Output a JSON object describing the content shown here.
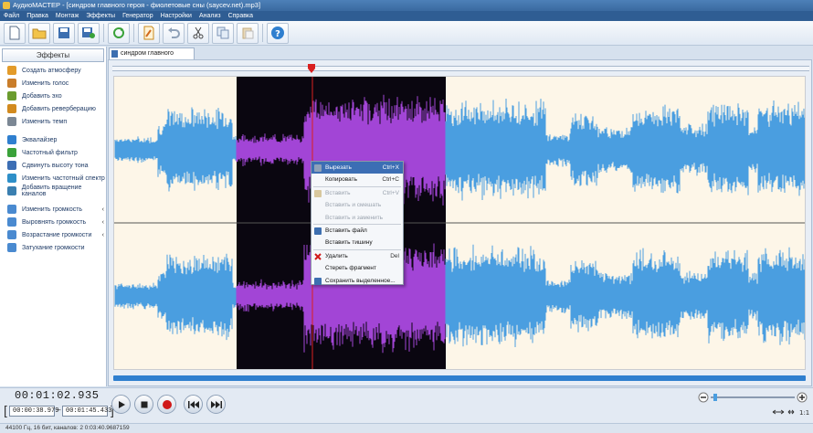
{
  "window": {
    "title": "АудиоМАСТЕР - [синдром главного героя - фиолетовые сны (saycev.net).mp3]"
  },
  "menu": [
    "Файл",
    "Правка",
    "Монтаж",
    "Эффекты",
    "Генератор",
    "Настройки",
    "Анализ",
    "Справка"
  ],
  "toolbar": {
    "icons": [
      "new-file-icon",
      "open-folder-icon",
      "save-icon",
      "save-as-icon",
      "refresh-icon",
      "edit-file-icon",
      "undo-icon",
      "cut-icon",
      "copy-icon",
      "paste-icon",
      "help-icon"
    ]
  },
  "sidebar": {
    "title": "Эффекты",
    "groups": [
      [
        {
          "label": "Создать атмосферу",
          "color": "#e39b2a"
        },
        {
          "label": "Изменить голос",
          "color": "#c97d2a"
        },
        {
          "label": "Добавить эхо",
          "color": "#6b9c2e"
        },
        {
          "label": "Добавить реверберацию",
          "color": "#d28a1e"
        },
        {
          "label": "Изменить темп",
          "color": "#7b8794"
        }
      ],
      [
        {
          "label": "Эквалайзер",
          "color": "#2f7fcf"
        },
        {
          "label": "Частотный фильтр",
          "color": "#3aa23a"
        },
        {
          "label": "Сдвинуть высоту тона",
          "color": "#3c6eb4"
        },
        {
          "label": "Изменить частотный спектр",
          "color": "#2e8fc8"
        },
        {
          "label": "Добавить вращение каналов",
          "color": "#3a7fb0"
        }
      ],
      [
        {
          "label": "Изменить громкость",
          "color": "#4a8ad0",
          "arrow": true
        },
        {
          "label": "Выровнять громкость",
          "color": "#4a8ad0",
          "arrow": true
        },
        {
          "label": "Возрастание громкости",
          "color": "#4a8ad0",
          "arrow": true
        },
        {
          "label": "Затухание громкости",
          "color": "#4a8ad0",
          "arrow": false
        }
      ]
    ]
  },
  "tab": {
    "label": "синдром главного героя..."
  },
  "context_menu": [
    {
      "label": "Вырезать",
      "shortcut": "Ctrl+X",
      "enabled": true,
      "selected": true,
      "icon": "cut-icon"
    },
    {
      "label": "Копировать",
      "shortcut": "Ctrl+C",
      "enabled": true,
      "selected": false,
      "icon": ""
    },
    "sep",
    {
      "label": "Вставить",
      "shortcut": "Ctrl+V",
      "enabled": false,
      "selected": false,
      "icon": "paste-icon"
    },
    {
      "label": "Вставить и смешать",
      "shortcut": "",
      "enabled": false,
      "selected": false,
      "icon": ""
    },
    {
      "label": "Вставить и заменить",
      "shortcut": "",
      "enabled": false,
      "selected": false,
      "icon": ""
    },
    "sep",
    {
      "label": "Вставить файл",
      "shortcut": "",
      "enabled": true,
      "selected": false,
      "icon": "insert-file-icon"
    },
    {
      "label": "Вставить тишину",
      "shortcut": "",
      "enabled": true,
      "selected": false,
      "icon": ""
    },
    "sep",
    {
      "label": "Удалить",
      "shortcut": "Del",
      "enabled": true,
      "selected": false,
      "icon": "delete-icon"
    },
    {
      "label": "Стереть фрагмент",
      "shortcut": "",
      "enabled": true,
      "selected": false,
      "icon": ""
    },
    {
      "label": "Сохранить выделенное...",
      "shortcut": "",
      "enabled": true,
      "selected": false,
      "icon": "save-selection-icon"
    }
  ],
  "playback": {
    "current_time": "00:01:02.935",
    "selection_start": "00:00:38.979",
    "selection_end": "00:01:45.433"
  },
  "status": {
    "text": "44100 Гц, 16 бит, каналов: 2    0:03:40.9687159"
  },
  "colors": {
    "wave": "#4a9ee0",
    "wave_selected": "#a245d6",
    "selection_bg": "#0a0610",
    "cursor": "#d92020",
    "background": "#fdf6e8"
  }
}
